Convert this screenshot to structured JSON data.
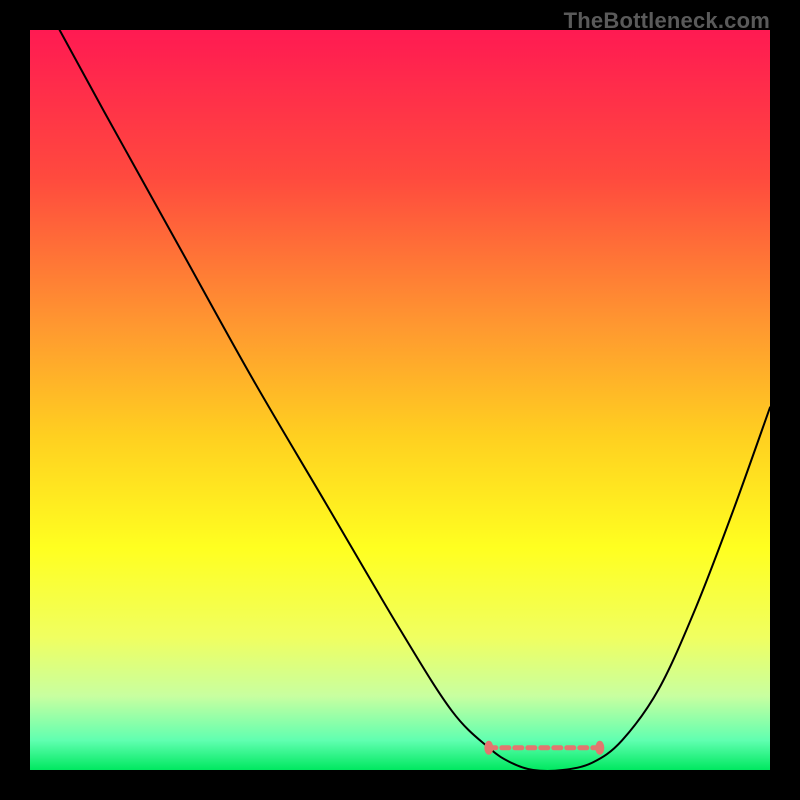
{
  "watermark": "TheBottleneck.com",
  "chart_data": {
    "type": "line",
    "title": "",
    "xlabel": "",
    "ylabel": "",
    "xlim": [
      0,
      100
    ],
    "ylim": [
      0,
      100
    ],
    "grid": false,
    "legend": false,
    "background_gradient": {
      "stops": [
        {
          "offset": 0.0,
          "color": "#ff1a52"
        },
        {
          "offset": 0.2,
          "color": "#ff4a3e"
        },
        {
          "offset": 0.4,
          "color": "#ff9830"
        },
        {
          "offset": 0.55,
          "color": "#ffd020"
        },
        {
          "offset": 0.7,
          "color": "#ffff20"
        },
        {
          "offset": 0.82,
          "color": "#f0ff60"
        },
        {
          "offset": 0.9,
          "color": "#c8ffa0"
        },
        {
          "offset": 0.96,
          "color": "#60ffb0"
        },
        {
          "offset": 1.0,
          "color": "#00e860"
        }
      ]
    },
    "series": [
      {
        "name": "bottleneck-curve",
        "color": "#000000",
        "stroke_width": 2,
        "x": [
          4,
          10,
          20,
          30,
          40,
          50,
          57,
          62,
          65,
          68,
          72,
          76,
          80,
          85,
          90,
          95,
          100
        ],
        "y": [
          100,
          89,
          71,
          53,
          36,
          19,
          8,
          3,
          1,
          0,
          0,
          1,
          4,
          11,
          22,
          35,
          49
        ]
      }
    ],
    "optimal_band": {
      "color": "#e2766f",
      "x_start": 62,
      "x_end": 77,
      "y": 3,
      "dot_left_x": 62,
      "dot_left_y": 3,
      "dot_right_x": 77,
      "dot_right_y": 3
    }
  }
}
